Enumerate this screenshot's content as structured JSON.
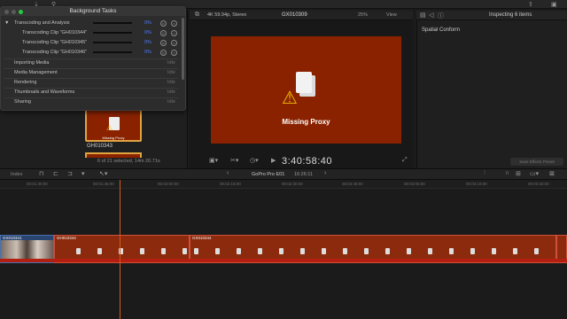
{
  "background_tasks": {
    "title": "Background Tasks",
    "group_label": "Transcoding and Analysis",
    "group_pct": "0%",
    "clips": [
      {
        "label": "Transcoding Clip \"GH010344\"",
        "pct": "0%"
      },
      {
        "label": "Transcoding Clip \"GH010345\"",
        "pct": "0%"
      },
      {
        "label": "Transcoding Clip \"GH010346\"",
        "pct": "0%"
      }
    ],
    "categories": [
      {
        "label": "Importing Media",
        "status": "Idle"
      },
      {
        "label": "Media Management",
        "status": "Idle"
      },
      {
        "label": "Rendering",
        "status": "Idle"
      },
      {
        "label": "Thumbnails and Waveforms",
        "status": "Idle"
      },
      {
        "label": "Sharing",
        "status": "Idle"
      }
    ]
  },
  "browser": {
    "clip_name": "GH010343",
    "thumb_label": "Missing Proxy",
    "status": "6 of 21 selected, 14m 20.71s"
  },
  "viewer": {
    "format": "4K 59.94p, Stereo",
    "clip_title": "GX010309",
    "zoom": "25%",
    "view_label": "View",
    "frame_message": "Missing Proxy",
    "timecode": "3:40:58:40"
  },
  "inspector": {
    "header": "Inspecting 6 items",
    "section": "Spatial Conform",
    "save_label": "Save Effects Preset"
  },
  "timeline": {
    "index_label": "Index",
    "project_name": "GoPro Pro E01",
    "duration": "16:26:11",
    "ruler": [
      "00:01:30:00",
      "00:01:45:00",
      "00:02:00:00",
      "00:02:15:00",
      "00:02:30:00",
      "00:02:45:00",
      "00:03:00:00",
      "00:03:15:00",
      "00:03:30:00",
      "00:03:45:00"
    ],
    "clips": [
      {
        "name": "GX010341"
      },
      {
        "name": "GH010344"
      },
      {
        "name": "GX010344"
      }
    ]
  },
  "colors": {
    "accent": "#4d7bff",
    "proxy_red": "#8a2200",
    "playhead": "#d45a1d",
    "selection": "#e0a440"
  }
}
